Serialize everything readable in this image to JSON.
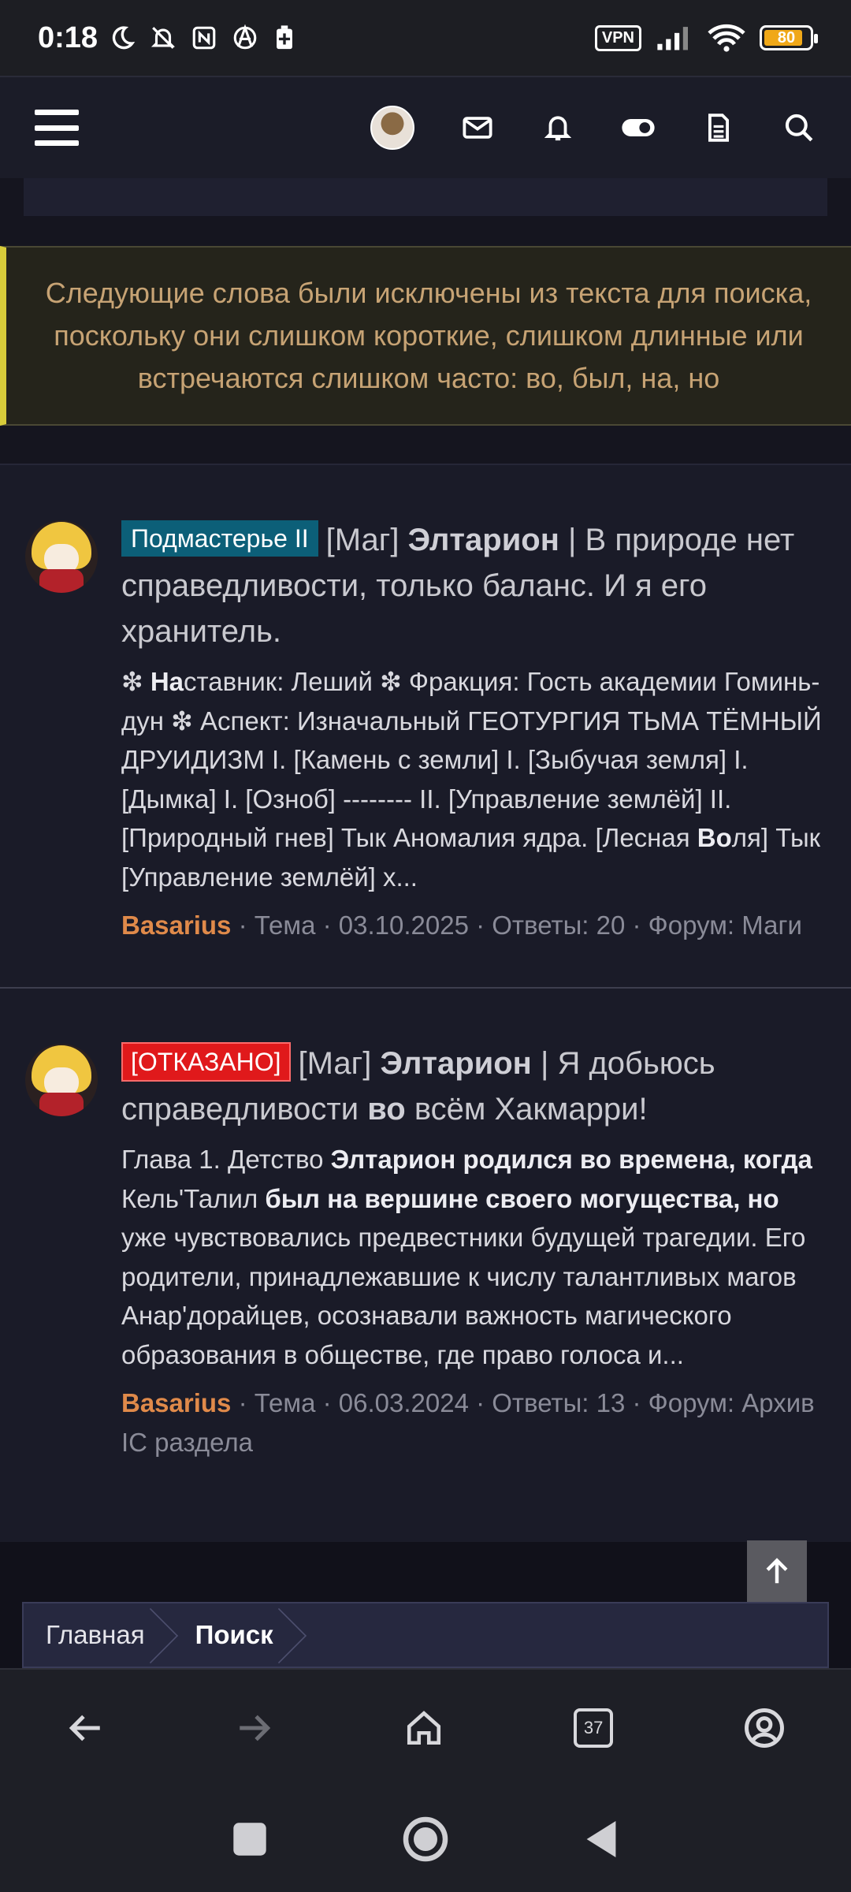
{
  "status_bar": {
    "time": "0:18",
    "vpn": "VPN",
    "battery": "80"
  },
  "header": {
    "icons": [
      "menu-icon",
      "avatar",
      "mail-icon",
      "bell-icon",
      "toggle-icon",
      "document-icon",
      "search-icon"
    ]
  },
  "notice": {
    "text": "Следующие слова были исключены из текста для поиска, поскольку они слишком короткие, слишком длинные или встречаются слишком часто: во, был, на, но"
  },
  "results": [
    {
      "badge": "Подмастерье II",
      "prefix": "[Маг]",
      "name": "Элтарион",
      "title_rest": "| В природе нет справедливости, только баланс. И я его хранитель.",
      "snippet_parts": {
        "s1": "❇ ",
        "b1": "На",
        "s2": "ставник: Леший ❇ Фракция: Гость академии Гоминь-дун ❇ Аспект: Изначальный ГЕОТУРГИЯ ТЬМА ТЁМНЫЙ ДРУИДИЗМ I. [Камень с земли] I. [Зыбучая земля] I. [Дымка] I. [Озноб] -------- II. [Управление землёй] II. [Природный гнев] Тык Аномалия ядра. [Лесная ",
        "b2": "Во",
        "s3": "ля] Тык [Управление землёй] х..."
      },
      "author": "Basarius",
      "meta": "· Тема · 03.10.2025 · Ответы: 20 · Форум: Маги"
    },
    {
      "badge": "[ОТКАЗАНО]",
      "prefix": "[Маг]",
      "name": "Элтарион",
      "title_mid": "| Я добьюсь справедливости",
      "title_bold": "во",
      "title_end": "всём Хакмарри!",
      "snippet_parts": {
        "s1": "Глава 1. Детство ",
        "b1": "Элтарион родился во времена, когда",
        "s2": " Кель'Талил ",
        "b2": "был на вершине своего могущества, но",
        "s3": " уже чувствовались предвестники будущей трагедии. Его родители, принадлежавшие к числу талантливых магов Анар'дорайцев, осознавали важность магического образования в обществе, где право голоса и..."
      },
      "author": "Basarius",
      "meta": "· Тема · 06.03.2024 · Ответы: 13 · Форум: Архив IC раздела"
    }
  ],
  "breadcrumb": {
    "home": "Главная",
    "current": "Поиск"
  },
  "browser_nav": {
    "tabs_count": "37"
  }
}
